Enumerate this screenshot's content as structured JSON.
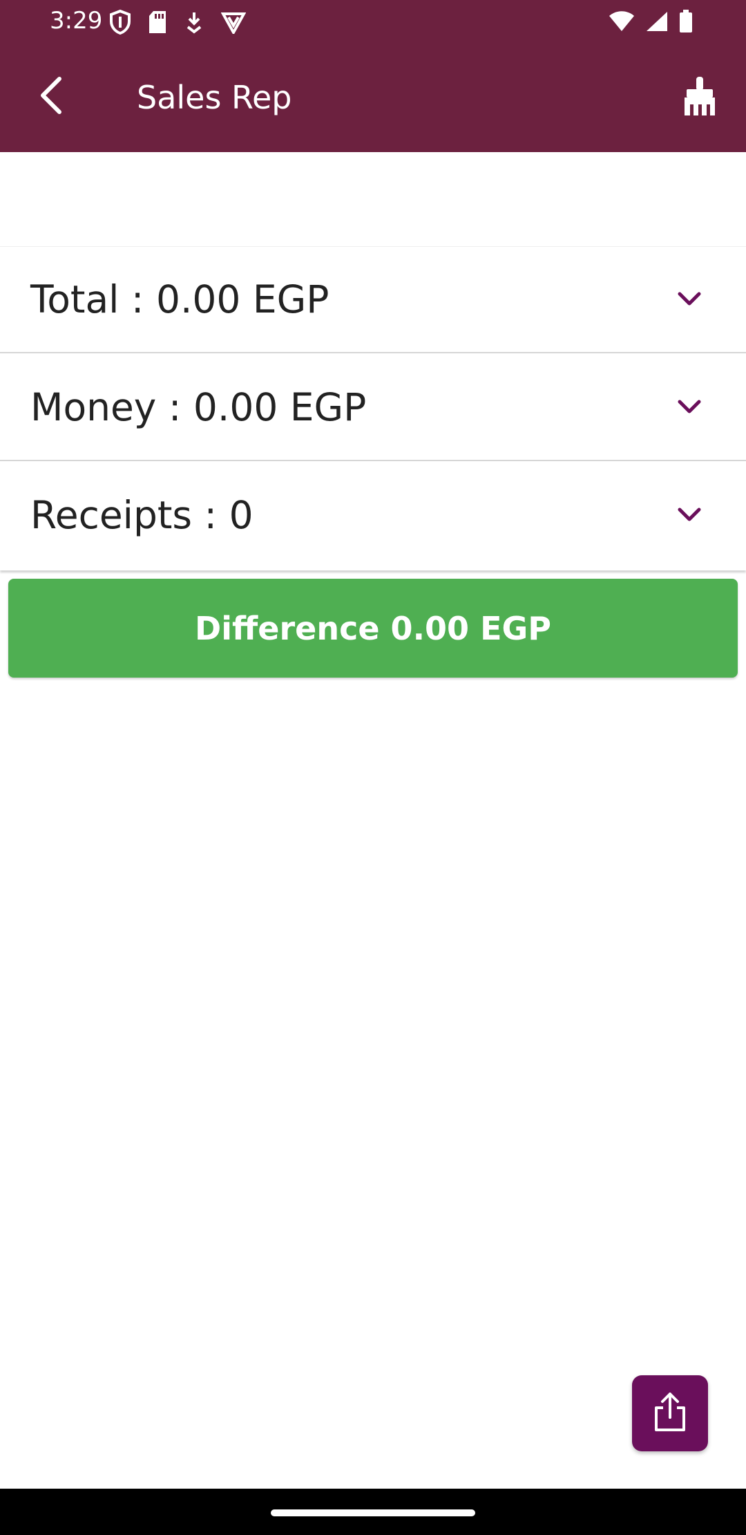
{
  "status_bar": {
    "time": "3:29",
    "left_icons": [
      "shield-icon",
      "sd-card-icon",
      "download-icon",
      "vpn-icon"
    ],
    "right_icons": [
      "wifi-icon",
      "signal-icon",
      "battery-icon"
    ]
  },
  "app_bar": {
    "title": "Sales Rep",
    "back_icon": "back-arrow-icon",
    "action_icon": "broom-icon",
    "background": "#6c213f"
  },
  "summary_rows": [
    {
      "label": "Total : 0.00 EGP",
      "icon": "chevron-down-icon"
    },
    {
      "label": "Money : 0.00 EGP",
      "icon": "chevron-down-icon"
    },
    {
      "label": "Receipts : 0",
      "icon": "chevron-down-icon"
    }
  ],
  "difference": {
    "label": "Difference 0.00 EGP",
    "color": "#4faf52"
  },
  "fab": {
    "icon": "share-icon",
    "color": "#6a0f5b"
  },
  "accent_color": "#6a0f5b"
}
